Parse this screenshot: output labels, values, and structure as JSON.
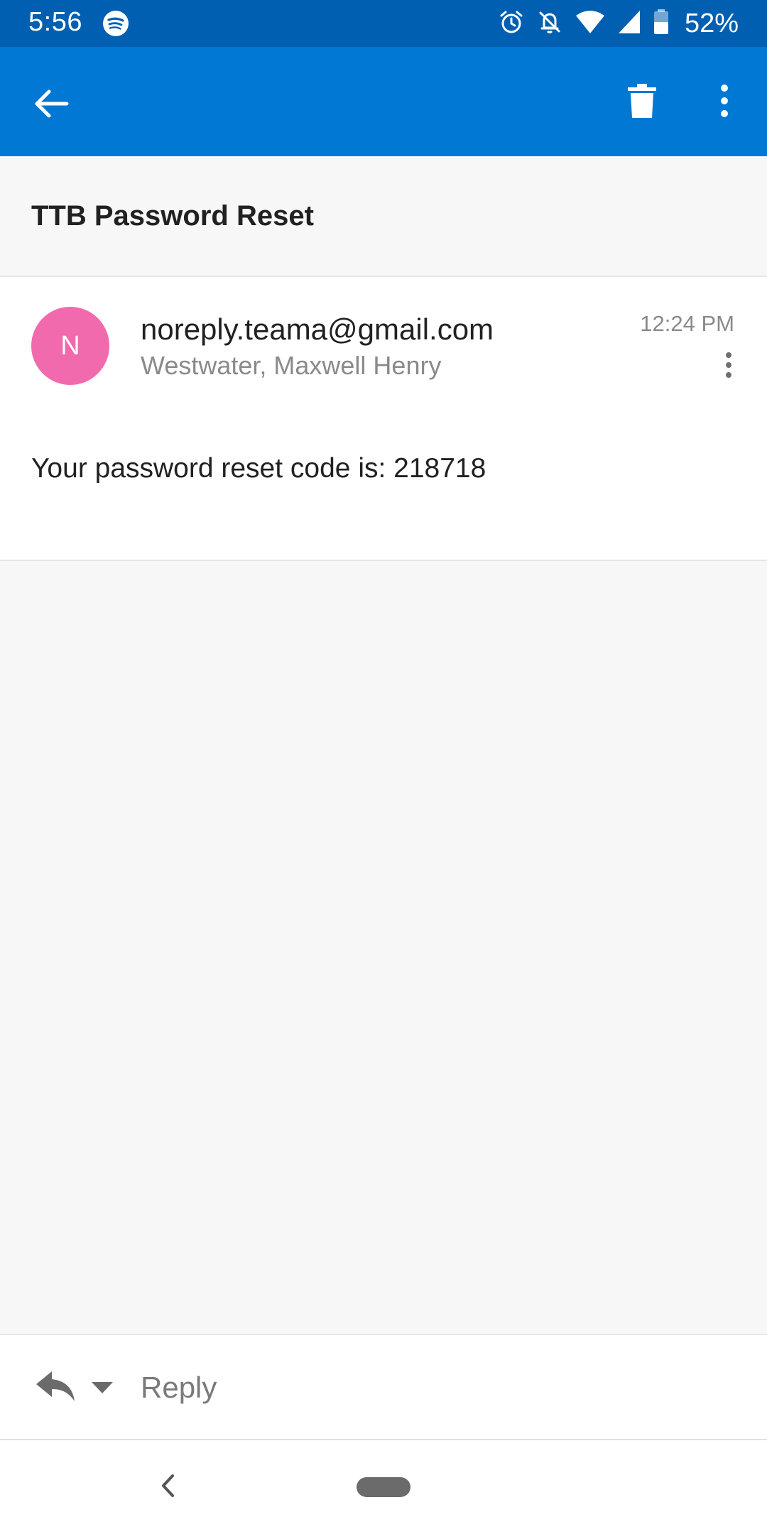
{
  "status_bar": {
    "time": "5:56",
    "battery": "52%",
    "icons": [
      "spotify-icon",
      "alarm-icon",
      "notifications-off-icon",
      "wifi-icon",
      "signal-icon",
      "battery-icon"
    ]
  },
  "app_bar": {
    "back_icon": "arrow-back-icon",
    "delete_icon": "trash-icon",
    "more_icon": "more-vert-icon",
    "color": "#0078d4"
  },
  "subject": {
    "title": "TTB Password Reset"
  },
  "message": {
    "avatar_initial": "N",
    "avatar_color": "#f06aad",
    "sender": "noreply.teama@gmail.com",
    "recipient": "Westwater, Maxwell Henry",
    "time": "12:24 PM",
    "body": "Your password reset code is: 218718"
  },
  "reply_bar": {
    "label": "Reply",
    "reply_icon": "reply-icon",
    "dropdown_icon": "caret-down-icon"
  },
  "nav_bar": {
    "back_icon": "nav-back-icon",
    "home_icon": "home-pill-icon"
  }
}
